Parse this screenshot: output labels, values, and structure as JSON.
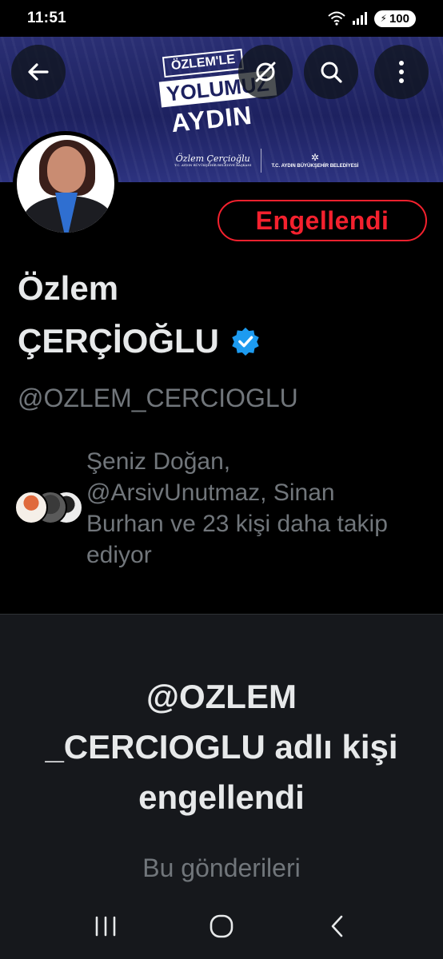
{
  "status_bar": {
    "time": "11:51",
    "battery": "100"
  },
  "banner": {
    "logo_line1": "ÖZLEM'LE",
    "logo_line2": "YOLUMUZ",
    "logo_line3": "AYDIN",
    "signature": "Özlem Çerçioğlu",
    "signature_caption": "T.C. AYDIN BÜYÜKŞEHİR BELEDİYE BAŞKANI",
    "municipality": "T.C. AYDIN BÜYÜKŞEHİR BELEDİYESİ"
  },
  "profile": {
    "name_line1": "Özlem",
    "name_line2": "ÇERÇİOĞLU",
    "handle": "@OZLEM_CERCIOGLU",
    "blocked_label": "Engellendi",
    "followed_by_text": "Şeniz Doğan, @ArsivUnutmaz, Sinan Burhan ve 23 kişi daha takip ediyor"
  },
  "blocked_panel": {
    "title": "@OZLEM _CERCIOGLU adlı kişi engellendi",
    "subtitle": "Bu gönderileri"
  },
  "icons": {
    "back": "arrow-left-icon",
    "grok": "grok-icon",
    "search": "search-icon",
    "more": "more-vertical-icon",
    "verified": "verified-badge-icon"
  },
  "colors": {
    "blocked_red": "#f4212e",
    "verified_blue": "#1d9bf0",
    "muted_text": "#71767b"
  }
}
